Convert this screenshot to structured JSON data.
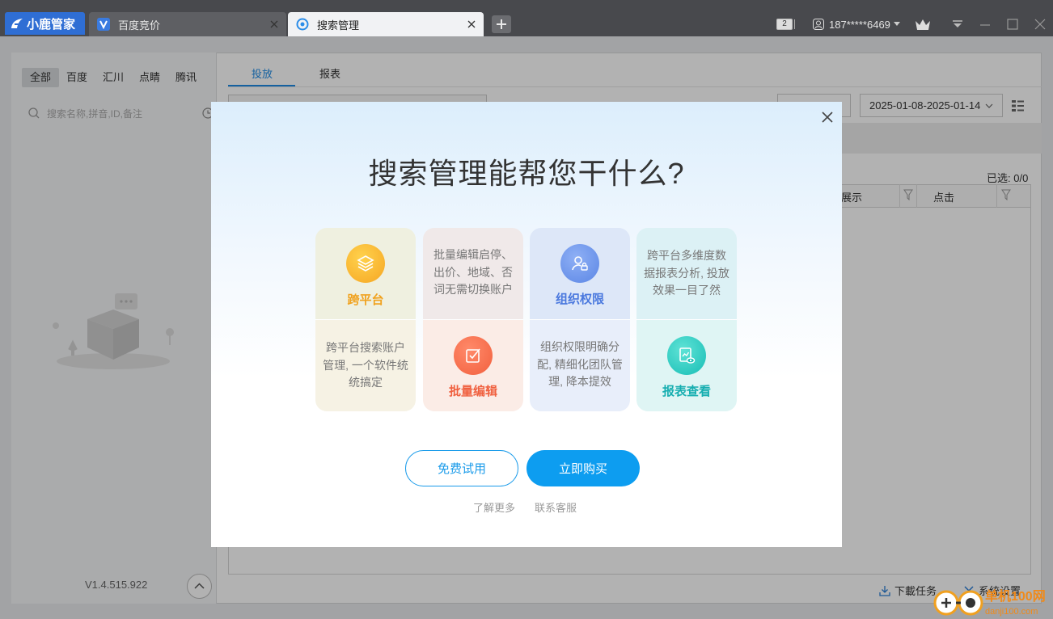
{
  "titlebar": {
    "logo_text": "小鹿管家",
    "tabs": [
      {
        "label": "百度竞价"
      },
      {
        "label": "搜索管理"
      }
    ],
    "notification_count": "2",
    "account": "187*****6469"
  },
  "sidebar": {
    "platform_tabs": [
      {
        "label": "全部"
      },
      {
        "label": "百度"
      },
      {
        "label": "汇川"
      },
      {
        "label": "点睛"
      },
      {
        "label": "腾讯"
      }
    ],
    "search_placeholder": "搜索名称,拼音,ID,备注",
    "version": "V1.4.515.922"
  },
  "main": {
    "tabs": [
      {
        "label": "投放"
      },
      {
        "label": "报表"
      }
    ],
    "date_range": "2025-01-08-2025-01-14",
    "selected": "已选: 0/0",
    "columns": [
      {
        "label": "展示"
      },
      {
        "label": "点击"
      }
    ],
    "footer": {
      "download": "下載任务",
      "settings": "系统设置"
    }
  },
  "modal": {
    "title": "搜索管理能帮您干什么?",
    "cards": [
      {
        "title": "跨平台",
        "desc": "跨平台搜索账户管理, 一个软件统统搞定",
        "icon": "layers-icon",
        "color": "#f6a623"
      },
      {
        "title": "批量编辑",
        "desc": "批量编辑启停、出价、地域、否词无需切换账户",
        "icon": "edit-check-icon",
        "color": "#f4694a"
      },
      {
        "title": "组织权限",
        "desc": "组织权限明确分配, 精细化团队管理, 降本提效",
        "icon": "user-lock-icon",
        "color": "#5b86e5"
      },
      {
        "title": "报表查看",
        "desc": "跨平台多维度数据报表分析, 投放效果一目了然",
        "icon": "report-eye-icon",
        "color": "#1fbfb8"
      }
    ],
    "trial_button": "免费试用",
    "buy_button": "立即购买",
    "learn_more": "了解更多",
    "contact_service": "联系客服"
  },
  "watermark": {
    "text": "单机100网",
    "url": "danji100.com"
  }
}
